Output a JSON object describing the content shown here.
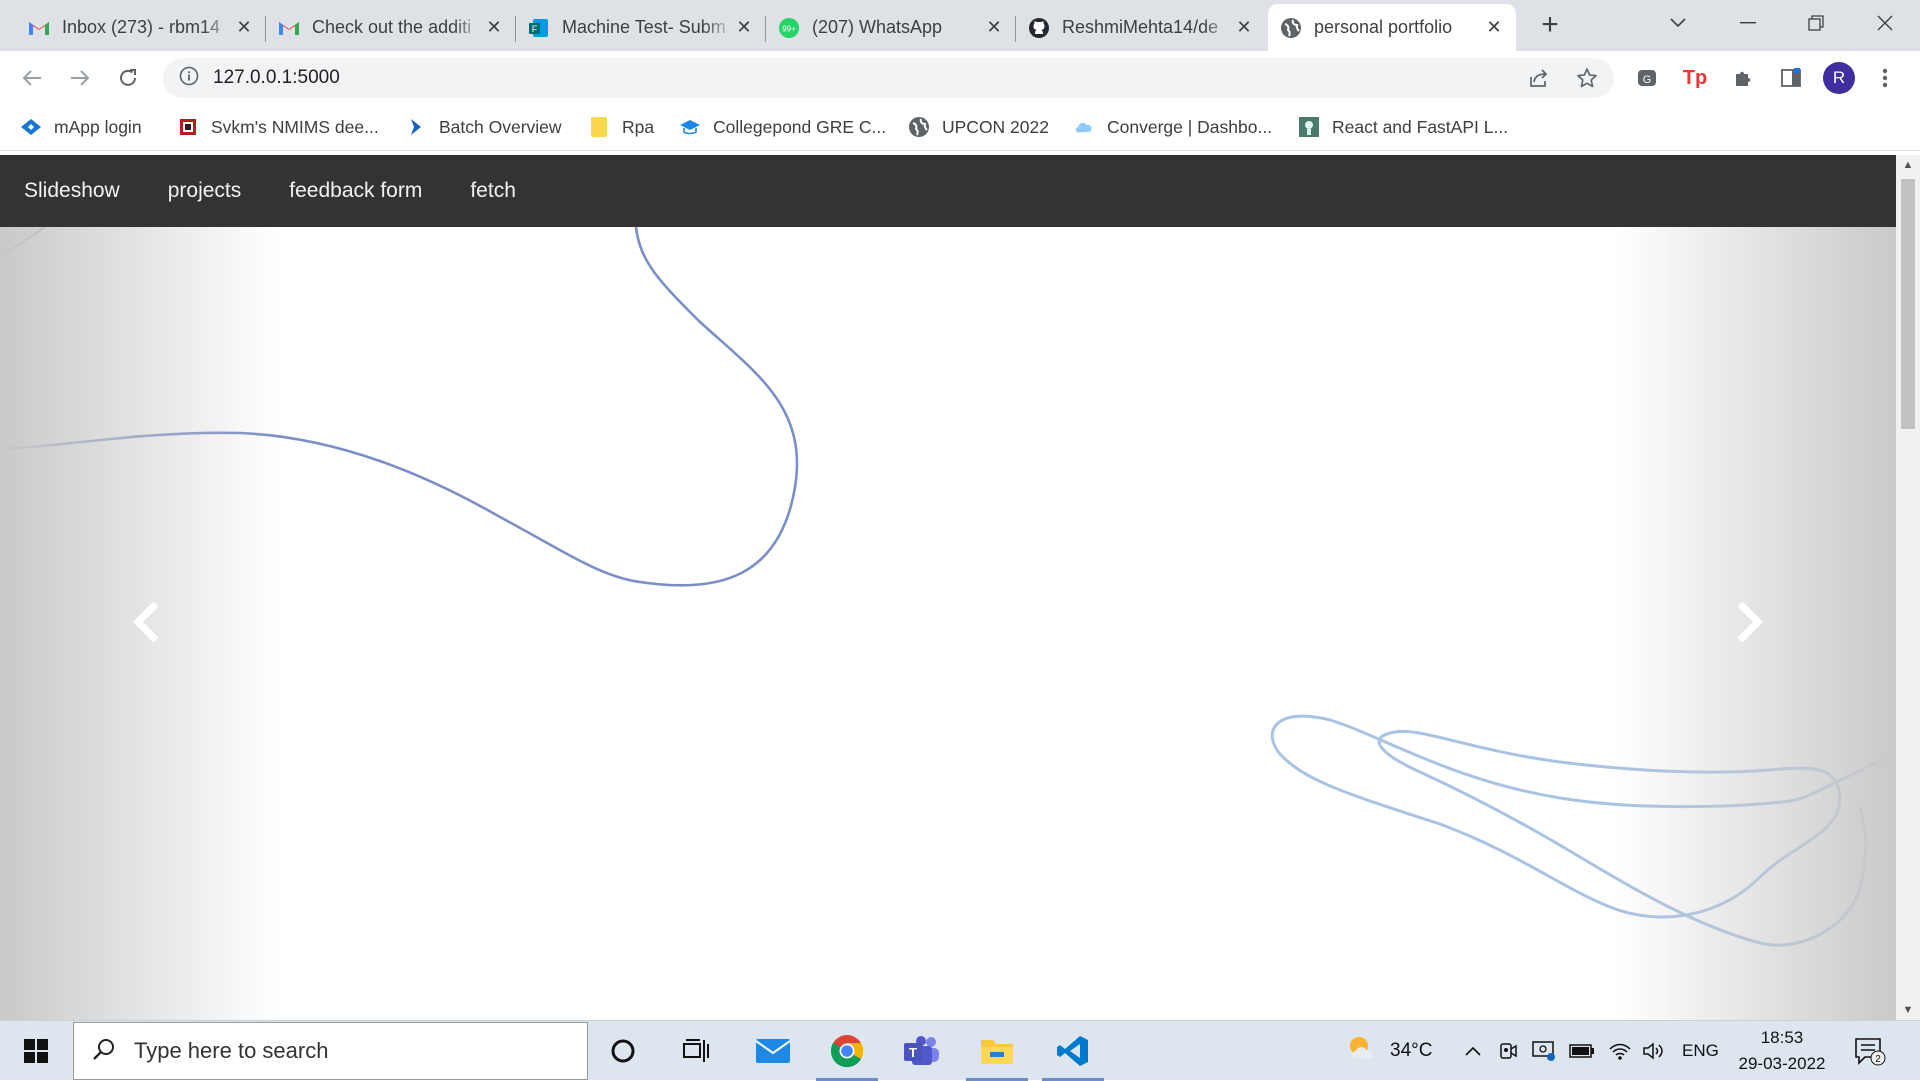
{
  "browser": {
    "tabs": [
      {
        "title": "Inbox (273) - rbm14",
        "icon": "gmail-icon"
      },
      {
        "title": "Check out the additi",
        "icon": "gmail-icon"
      },
      {
        "title": "Machine Test- Subm",
        "icon": "forms-icon"
      },
      {
        "title": "(207) WhatsApp",
        "icon": "whatsapp-icon",
        "badge": "99+"
      },
      {
        "title": "ReshmiMehta14/de",
        "icon": "github-icon"
      },
      {
        "title": "personal portfolio",
        "icon": "globe-icon",
        "active": true
      }
    ],
    "url": "127.0.0.1:5000",
    "profile_initial": "R",
    "bookmarks": [
      {
        "label": "mApp login"
      },
      {
        "label": "Svkm's NMIMS dee..."
      },
      {
        "label": "Batch Overview"
      },
      {
        "label": "Rpa"
      },
      {
        "label": "Collegepond GRE C..."
      },
      {
        "label": "UPCON 2022"
      },
      {
        "label": "Converge | Dashbo..."
      },
      {
        "label": "React and FastAPI L..."
      }
    ]
  },
  "site": {
    "nav": [
      "Slideshow",
      "projects",
      "feedback form",
      "fetch"
    ],
    "line_color": "#7b8fc7",
    "line_color_light": "#a9c3e4"
  },
  "taskbar": {
    "search_placeholder": "Type here to search",
    "weather": "34°C",
    "language": "ENG",
    "time": "18:53",
    "date": "29-03-2022",
    "notifications": "2"
  }
}
